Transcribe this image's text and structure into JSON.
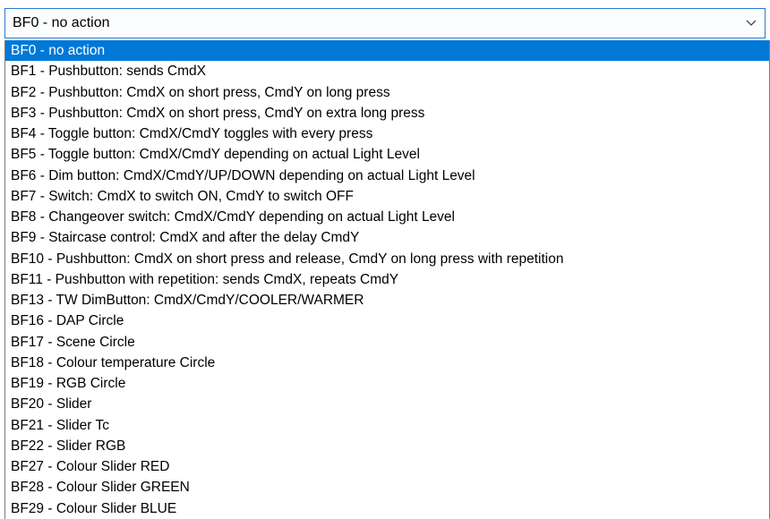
{
  "colors": {
    "accent": "#0078d7",
    "border": "#2a79d0",
    "selected_text": "#ffffff"
  },
  "combo": {
    "value": "BF0 - no action",
    "arrow_icon": "chevron-down-icon"
  },
  "list": {
    "selected_index": 0,
    "items": [
      "BF0 - no action",
      "BF1 - Pushbutton:  sends CmdX",
      "BF2 - Pushbutton:  CmdX on short press, CmdY on long press",
      "BF3 - Pushbutton:  CmdX on short press, CmdY on extra long press",
      "BF4 - Toggle button:  CmdX/CmdY toggles with every press",
      "BF5 - Toggle button:  CmdX/CmdY depending on actual Light Level",
      "BF6 - Dim button:  CmdX/CmdY/UP/DOWN depending on actual Light Level",
      "BF7 - Switch:  CmdX to switch ON, CmdY to switch OFF",
      "BF8 - Changeover switch:  CmdX/CmdY depending on actual Light Level",
      "BF9 - Staircase control:  CmdX and after the delay CmdY",
      "BF10 - Pushbutton:  CmdX on short press and release, CmdY on long press with repetition",
      "BF11 - Pushbutton with repetition: sends CmdX, repeats CmdY",
      "BF13 - TW DimButton:  CmdX/CmdY/COOLER/WARMER",
      "BF16 - DAP Circle",
      "BF17 - Scene Circle",
      "BF18 - Colour temperature Circle",
      "BF19 - RGB Circle",
      "BF20 - Slider",
      "BF21 - Slider Tc",
      "BF22 - Slider RGB",
      "BF27 - Colour Slider RED",
      "BF28 - Colour Slider GREEN",
      "BF29 - Colour Slider BLUE"
    ]
  }
}
